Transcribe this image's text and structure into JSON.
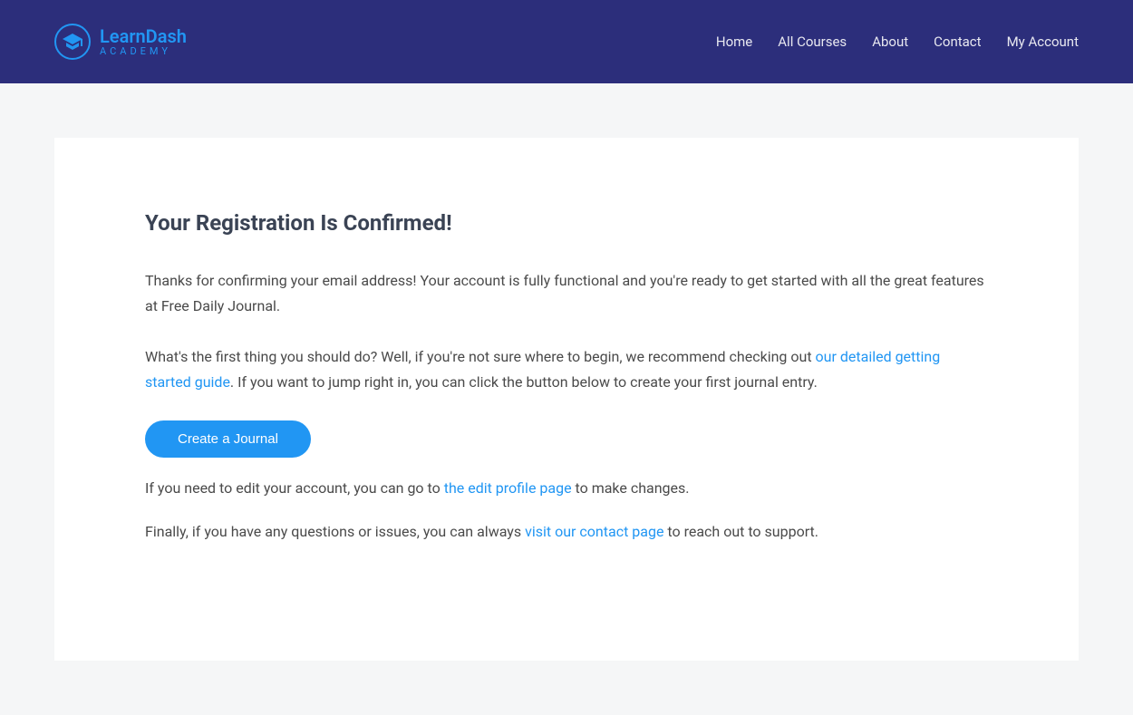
{
  "logo": {
    "main": "LearnDash",
    "sub": "ACADEMY"
  },
  "nav": {
    "home": "Home",
    "all_courses": "All Courses",
    "about": "About",
    "contact": "Contact",
    "my_account": "My Account"
  },
  "content": {
    "title": "Your Registration Is Confirmed!",
    "p1": "Thanks for confirming your email address! Your account is fully functional and you're ready to get started with all the great features at Free Daily Journal.",
    "p2_a": "What's the first thing you should do? Well, if you're not sure where to begin, we recommend checking out ",
    "p2_link": "our detailed getting started guide",
    "p2_b": ". If you want to jump right in, you can click the button below to create your first journal entry.",
    "button_label": "Create a Journal",
    "p3_a": "If you need to edit your account, you can go to ",
    "p3_link": "the edit profile page",
    "p3_b": " to make changes.",
    "p4_a": "Finally, if you have any questions or issues, you can always ",
    "p4_link": "visit our contact page",
    "p4_b": " to reach out to support."
  }
}
